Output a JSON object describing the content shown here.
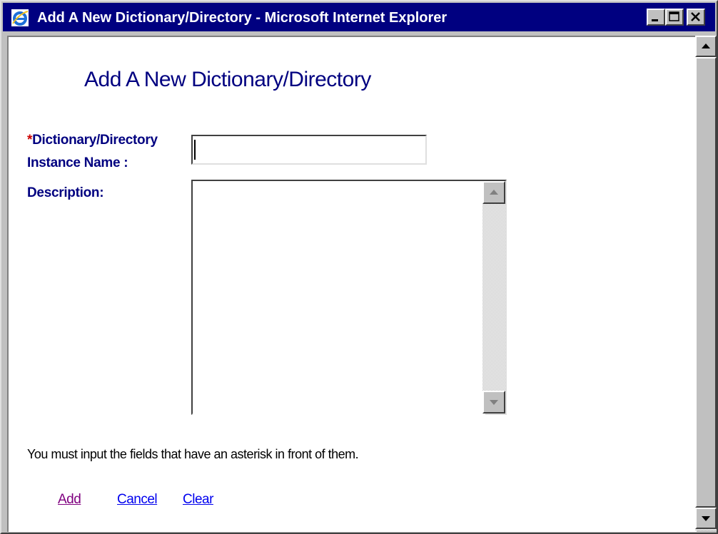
{
  "window": {
    "title": "Add A New Dictionary/Directory - Microsoft Internet Explorer",
    "icon": "ie-icon",
    "controls": [
      "minimize-icon",
      "maximize-icon",
      "close-icon"
    ],
    "title_bar_color": "#000080"
  },
  "page": {
    "heading": "Add A New Dictionary/Directory",
    "heading_color": "#000080"
  },
  "form": {
    "name_field": {
      "required_marker": "*",
      "label_line1": "Dictionary/Directory",
      "label_line2": "Instance Name :",
      "value": ""
    },
    "description_field": {
      "label": "Description:",
      "value": ""
    }
  },
  "note": "You must input the fields that have an asterisk in front of them.",
  "actions": {
    "add": "Add",
    "cancel": "Cancel",
    "clear": "Clear"
  },
  "colors": {
    "label": "#000080",
    "required": "#cc0000",
    "link": "#0000ee",
    "visited_link": "#800080"
  }
}
